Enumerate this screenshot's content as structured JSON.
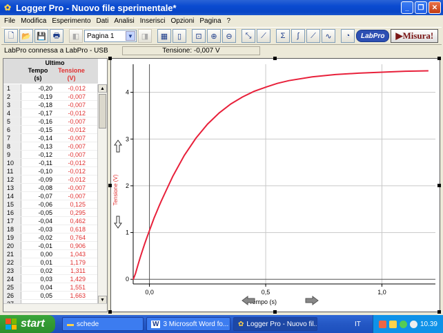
{
  "window": {
    "title": "Logger Pro - Nuovo file sperimentale*"
  },
  "menu": [
    "File",
    "Modifica",
    "Esperimento",
    "Dati",
    "Analisi",
    "Inserisci",
    "Opzioni",
    "Pagina",
    "?"
  ],
  "toolbar": {
    "page_select": "Pagina 1",
    "labpro_label": "LabPro",
    "misura_label": "Misura!"
  },
  "status": {
    "connection": "LabPro connessa a LabPro - USB",
    "readout": "Tensione: -0,007 V"
  },
  "table": {
    "group": "Ultimo",
    "col_time": "Tempo",
    "col_time_unit": "(s)",
    "col_volt": "Tensione",
    "col_volt_unit": "(V)",
    "rows": [
      [
        "1",
        "-0,20",
        "-0,012"
      ],
      [
        "2",
        "-0,19",
        "-0,007"
      ],
      [
        "3",
        "-0,18",
        "-0,007"
      ],
      [
        "4",
        "-0,17",
        "-0,012"
      ],
      [
        "5",
        "-0,16",
        "-0,007"
      ],
      [
        "6",
        "-0,15",
        "-0,012"
      ],
      [
        "7",
        "-0,14",
        "-0,007"
      ],
      [
        "8",
        "-0,13",
        "-0,007"
      ],
      [
        "9",
        "-0,12",
        "-0,007"
      ],
      [
        "10",
        "-0,11",
        "-0,012"
      ],
      [
        "11",
        "-0,10",
        "-0,012"
      ],
      [
        "12",
        "-0,09",
        "-0,012"
      ],
      [
        "13",
        "-0,08",
        "-0,007"
      ],
      [
        "14",
        "-0,07",
        "-0,007"
      ],
      [
        "15",
        "-0,06",
        "0,125"
      ],
      [
        "16",
        "-0,05",
        "0,295"
      ],
      [
        "17",
        "-0,04",
        "0,462"
      ],
      [
        "18",
        "-0,03",
        "0,618"
      ],
      [
        "19",
        "-0,02",
        "0,764"
      ],
      [
        "20",
        "-0,01",
        "0,906"
      ],
      [
        "21",
        "0,00",
        "1,043"
      ],
      [
        "22",
        "0,01",
        "1,179"
      ],
      [
        "23",
        "0,02",
        "1,311"
      ],
      [
        "24",
        "0,03",
        "1,429"
      ],
      [
        "25",
        "0,04",
        "1,551"
      ],
      [
        "26",
        "0,05",
        "1,663"
      ],
      [
        "27",
        "",
        ""
      ]
    ]
  },
  "chart_data": {
    "type": "line",
    "xlabel": "Tempo (s)",
    "ylabel": "Tensione (V)",
    "xlim": [
      -0.07,
      1.23
    ],
    "ylim": [
      -0.1,
      4.6
    ],
    "x_ticks": [
      "0,0",
      "0,5",
      "1,0"
    ],
    "x_tick_values": [
      0.0,
      0.5,
      1.0
    ],
    "y_ticks": [
      "0",
      "1",
      "2",
      "3",
      "4"
    ],
    "y_tick_values": [
      0,
      1,
      2,
      3,
      4
    ],
    "grid": true,
    "series": [
      {
        "color": "#e8203a",
        "x": [
          -0.07,
          -0.06,
          -0.05,
          -0.04,
          -0.03,
          -0.02,
          -0.01,
          0.0,
          0.01,
          0.02,
          0.03,
          0.04,
          0.05,
          0.07,
          0.1,
          0.15,
          0.2,
          0.25,
          0.3,
          0.35,
          0.4,
          0.45,
          0.5,
          0.55,
          0.6,
          0.7,
          0.8,
          0.9,
          1.0,
          1.1,
          1.2
        ],
        "y": [
          -0.007,
          0.125,
          0.295,
          0.462,
          0.618,
          0.764,
          0.906,
          1.043,
          1.179,
          1.311,
          1.429,
          1.551,
          1.663,
          1.88,
          2.2,
          2.65,
          3.02,
          3.32,
          3.56,
          3.75,
          3.9,
          4.02,
          4.11,
          4.19,
          4.25,
          4.33,
          4.38,
          4.41,
          4.43,
          4.45,
          4.46
        ]
      }
    ]
  },
  "taskbar": {
    "start": "start",
    "tasks": [
      "schede",
      "3 Microsoft Word fo...",
      "Logger Pro - Nuovo fil..."
    ],
    "lang": "IT",
    "clock": "10.39"
  }
}
